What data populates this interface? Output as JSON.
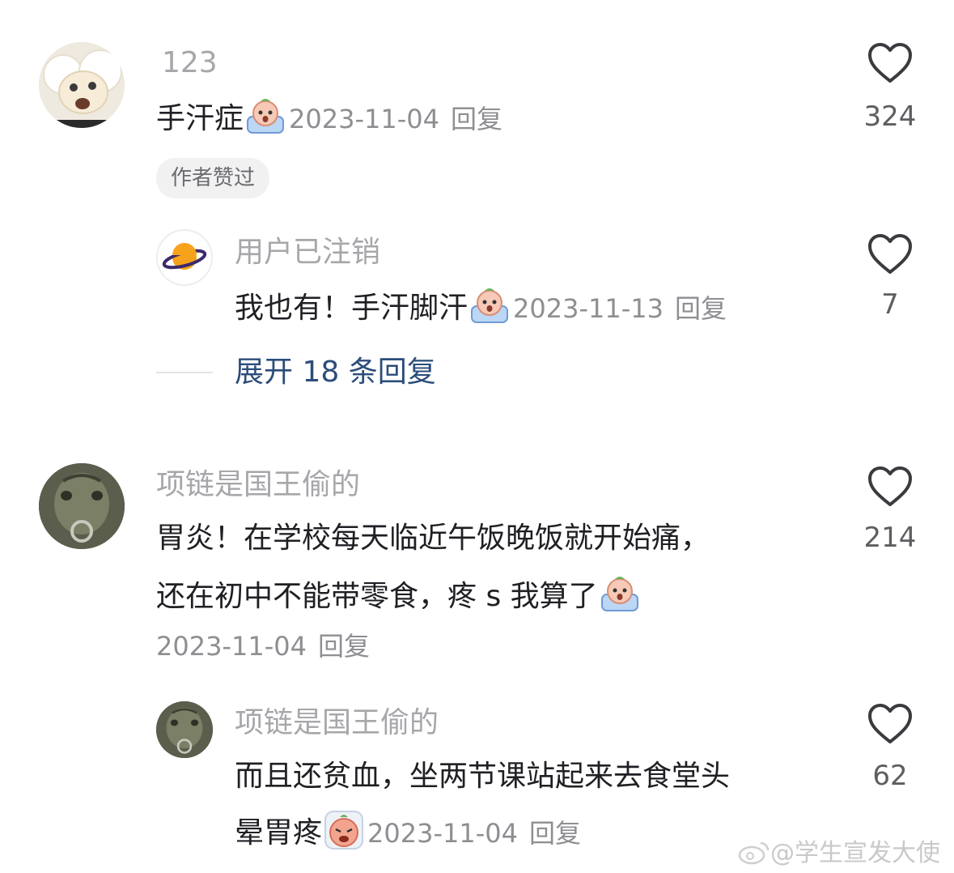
{
  "comments": [
    {
      "username": "123",
      "text": "手汗症",
      "emoji": "crying-face-emoji",
      "date": "2023-11-04",
      "reply_label": "回复",
      "likes": "324",
      "badge": "作者赞过"
    },
    {
      "username": "用户已注销",
      "text": "我也有！手汗脚汗",
      "emoji": "crying-face-emoji",
      "date": "2023-11-13",
      "reply_label": "回复",
      "likes": "7"
    },
    {
      "username": "项链是国王偷的",
      "text_line1": "胃炎！在学校每天临近午饭晚饭就开始痛，",
      "text_line2": "还在初中不能带零食，疼 s 我算了",
      "emoji": "crying-face-emoji",
      "date": "2023-11-04",
      "reply_label": "回复",
      "likes": "214"
    },
    {
      "username": "项链是国王偷的",
      "text_line1": "而且还贫血，坐两节课站起来去食堂头",
      "text_line2": "晕胃疼",
      "emoji": "sick-face-emoji",
      "date": "2023-11-04",
      "reply_label": "回复",
      "likes": "62"
    }
  ],
  "expand_replies": "展开 18 条回复",
  "watermark": "@学生宣发大使",
  "colors": {
    "username": "#a7a7ab",
    "link": "#2b4d7a",
    "meta": "#8e8e93"
  }
}
